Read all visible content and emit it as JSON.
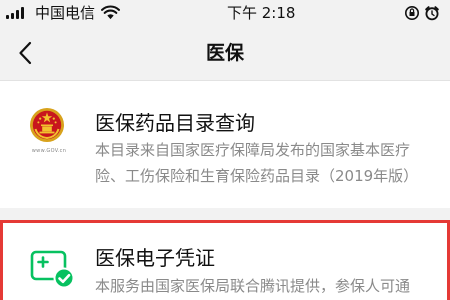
{
  "status_bar": {
    "carrier": "中国电信",
    "time": "下午 2:18"
  },
  "nav": {
    "title": "医保"
  },
  "items": [
    {
      "title": "医保药品目录查询",
      "desc_line1": "本目录来自国家医疗保障局发布的国家基本医疗",
      "desc_line2": "险、工伤保险和生育保险药品目录（2019年版）",
      "icon": "national-emblem-icon",
      "icon_caption": "www.GOV.cn"
    },
    {
      "title": "医保电子凭证",
      "desc_line1": "本服务由国家医保局联合腾讯提供，参保人可通",
      "icon": "medical-voucher-icon",
      "highlighted": true
    }
  ],
  "colors": {
    "highlight_border": "#e53935",
    "voucher_green": "#07c160",
    "page_bg": "#f2f2f2"
  }
}
